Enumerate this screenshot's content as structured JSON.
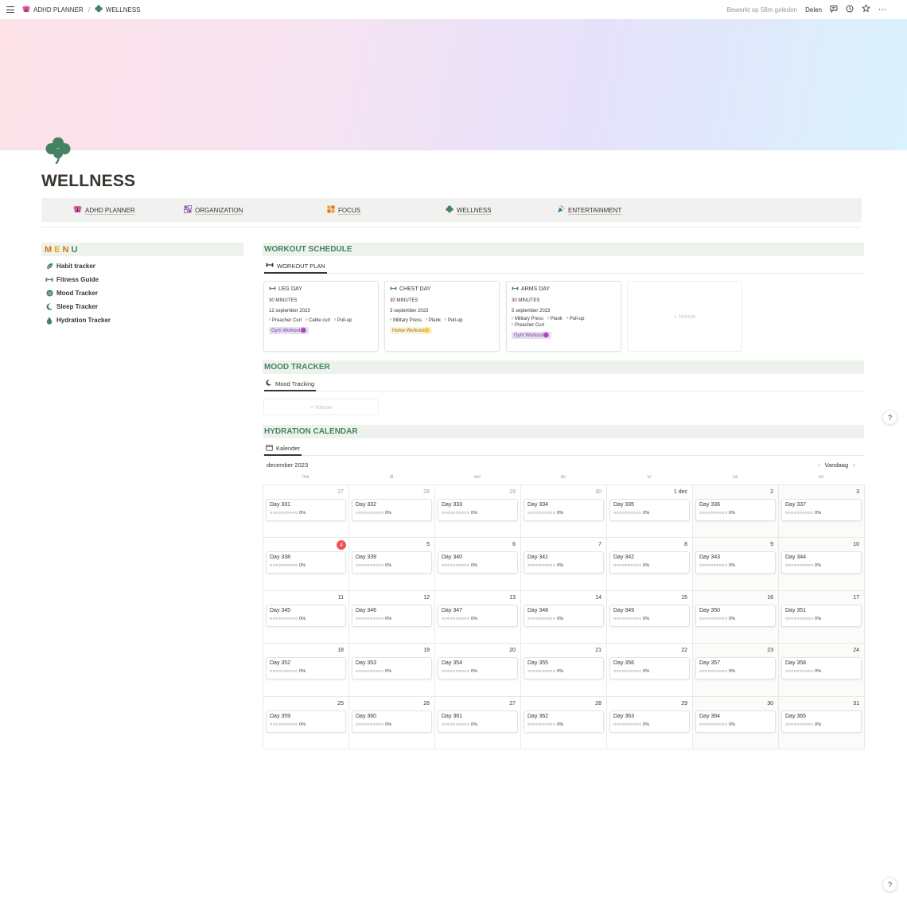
{
  "topbar": {
    "breadcrumb": [
      {
        "icon": "butterfly-icon",
        "label": "ADHD PLANNER"
      },
      {
        "icon": "clover-icon",
        "label": "WELLNESS"
      }
    ],
    "separator": "/",
    "edited": "Bewerkt op 58m geleden",
    "share": "Delen"
  },
  "page": {
    "title": "WELLNESS",
    "icon": "clover-icon",
    "accent": "#448361"
  },
  "nav": {
    "dot": "·",
    "items": [
      {
        "icon": "butterfly-icon",
        "label": "ADHD PLANNER"
      },
      {
        "icon": "grid-icon",
        "label": "ORGANIZATION"
      },
      {
        "icon": "puzzle-icon",
        "label": "FOCUS"
      },
      {
        "icon": "clover-icon",
        "label": "WELLNESS"
      },
      {
        "icon": "party-popper-icon",
        "label": "ENTERTAINMENT"
      }
    ]
  },
  "menu": {
    "heading_letters": [
      {
        "ch": "M",
        "color": "#d9730d"
      },
      {
        "ch": "E",
        "color": "#dfab01"
      },
      {
        "ch": "N",
        "color": "#d9730d"
      },
      {
        "ch": "U",
        "color": "#448361"
      }
    ],
    "items": [
      {
        "icon": "leaf-icon",
        "label": "Habit tracker"
      },
      {
        "icon": "dumbbell-icon",
        "label": "Fitness Guide"
      },
      {
        "icon": "smiley-icon",
        "label": "Mood Tracker"
      },
      {
        "icon": "moon-icon",
        "label": "Sleep Tracker"
      },
      {
        "icon": "water-drop-icon",
        "label": "Hydration Tracker"
      }
    ]
  },
  "workout": {
    "heading": "WORKOUT SCHEDULE",
    "tab": "WORKOUT PLAN",
    "cards": [
      {
        "title": "LEG DAY",
        "duration": "30 MINUTES",
        "date": "12 september 2023",
        "exercises": [
          "Preacher Curl",
          "Cable curl",
          "Pull-up"
        ],
        "tag": "Gym Workout🟣",
        "tag_style": "purple"
      },
      {
        "title": "CHEST DAY",
        "duration": "30 MINUTES",
        "date": "3 september 2023",
        "exercises": [
          "Military Press",
          "Plank",
          "Pull-up"
        ],
        "tag": "Home Workout🟡",
        "tag_style": "yellow"
      },
      {
        "title": "ARMS DAY",
        "duration": "30 MINUTES",
        "date": "5 september 2023",
        "exercises": [
          "Military Press",
          "Plank",
          "Pull-up",
          "Preacher Curl"
        ],
        "tag": "Gym Workout🟣",
        "tag_style": "purple"
      }
    ],
    "new_label": "+ Nieuw"
  },
  "mood": {
    "heading": "MOOD TRACKER",
    "tab": "Mood Tracking",
    "new_label": "+ Nieuw"
  },
  "hydration": {
    "heading": "HYDRATION CALENDAR",
    "tab": "Kalender",
    "month": "december 2023",
    "today_label": "Vandaag",
    "weekdays": [
      "ma",
      "di",
      "wo",
      "do",
      "vr",
      "za",
      "zo"
    ],
    "progress": "○○○○○○○○○○ 0%",
    "today_day": "4",
    "weeks": [
      {
        "dates": [
          "27",
          "28",
          "29",
          "30",
          "1 dec",
          "2",
          "3"
        ],
        "days": [
          "Day 331",
          "Day 332",
          "Day 333",
          "Day 334",
          "Day 335",
          "Day 336",
          "Day 337"
        ]
      },
      {
        "dates": [
          "4",
          "5",
          "6",
          "7",
          "8",
          "9",
          "10"
        ],
        "days": [
          "Day 338",
          "Day 339",
          "Day 340",
          "Day 341",
          "Day 342",
          "Day 343",
          "Day 344"
        ]
      },
      {
        "dates": [
          "11",
          "12",
          "13",
          "14",
          "15",
          "16",
          "17"
        ],
        "days": [
          "Day 345",
          "Day 346",
          "Day 347",
          "Day 348",
          "Day 349",
          "Day 350",
          "Day 351"
        ]
      },
      {
        "dates": [
          "18",
          "19",
          "20",
          "21",
          "22",
          "23",
          "24"
        ],
        "days": [
          "Day 352",
          "Day 353",
          "Day 354",
          "Day 355",
          "Day 356",
          "Day 357",
          "Day 358"
        ]
      },
      {
        "dates": [
          "25",
          "26",
          "27",
          "28",
          "29",
          "30",
          "31"
        ],
        "days": [
          "Day 359",
          "Day 360",
          "Day 361",
          "Day 362",
          "Day 363",
          "Day 364",
          "Day 365"
        ]
      }
    ]
  },
  "help_label": "?"
}
